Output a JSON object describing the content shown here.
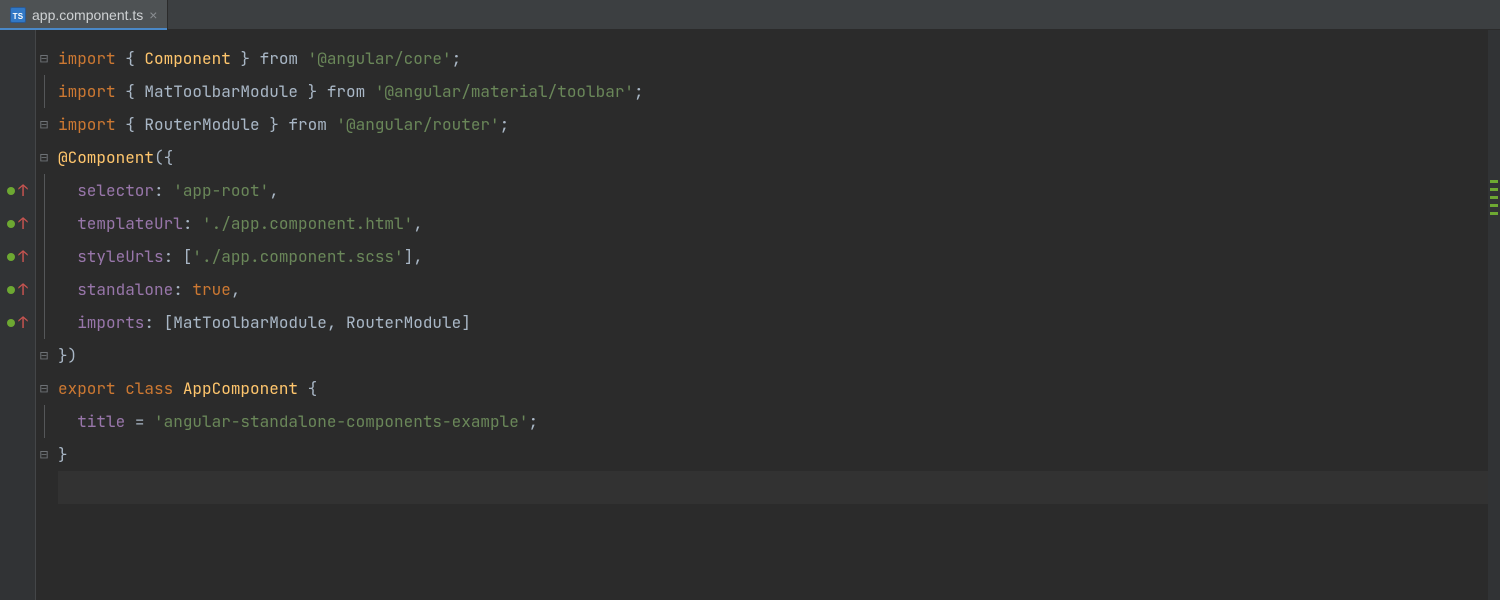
{
  "tab": {
    "filename": "app.component.ts",
    "icon_label": "TS"
  },
  "code": {
    "lines": [
      {
        "fold": "open",
        "tokens": [
          "import ",
          "{ ",
          "Component",
          " }",
          " from ",
          "'@angular/core'",
          ";"
        ]
      },
      {
        "fold": "line",
        "tokens": [
          "import ",
          "{ ",
          "MatToolbarModule",
          " }",
          " from ",
          "'@angular/material/toolbar'",
          ";"
        ]
      },
      {
        "fold": "close",
        "tokens": [
          "import ",
          "{ ",
          "RouterModule",
          " }",
          " from ",
          "'@angular/router'",
          ";"
        ]
      },
      {
        "fold": "open",
        "tokens": [
          "@Component",
          "({"
        ]
      },
      {
        "vcs": true,
        "fold": "line",
        "indent": "  ",
        "tokens": [
          "selector",
          ": ",
          "'app-root'",
          ","
        ]
      },
      {
        "vcs": true,
        "fold": "line",
        "indent": "  ",
        "tokens": [
          "templateUrl",
          ": ",
          "'./app.component.html'",
          ","
        ]
      },
      {
        "vcs": true,
        "fold": "line",
        "indent": "  ",
        "tokens": [
          "styleUrls",
          ": [",
          "'./app.component.scss'",
          "],"
        ]
      },
      {
        "vcs": true,
        "fold": "line",
        "indent": "  ",
        "tokens": [
          "standalone",
          ": ",
          "true",
          ","
        ]
      },
      {
        "vcs": true,
        "fold": "line",
        "indent": "  ",
        "tokens": [
          "imports",
          ": [",
          "MatToolbarModule",
          ", ",
          "RouterModule",
          "]"
        ]
      },
      {
        "fold": "close",
        "tokens": [
          "})"
        ]
      },
      {
        "fold": "open",
        "tokens": [
          "export ",
          "class ",
          "AppComponent",
          " {"
        ]
      },
      {
        "fold": "line",
        "indent": "  ",
        "tokens": [
          "title",
          " = ",
          "'angular-standalone-components-example'",
          ";"
        ]
      },
      {
        "fold": "close",
        "tokens": [
          "}"
        ]
      },
      {
        "current": true,
        "tokens": [
          ""
        ]
      }
    ]
  },
  "token_classes": {
    "import ": "kw",
    "from ": "kw",
    "export ": "kw",
    "class ": "kw",
    "true": "kw",
    "{ ": "id",
    " }": "id",
    " {": "id",
    "}": "id",
    "})": "id",
    "({": "id",
    ": [": "id",
    "],": "id",
    "]": "id",
    ", ": "id",
    ": ": "id",
    " = ": "id",
    ";": "op",
    ",": "op",
    "Component": "name",
    "@Component": "name",
    "AppComponent": "name",
    "MatToolbarModule": "id",
    "RouterModule": "id",
    "selector": "prop",
    "templateUrl": "prop",
    "styleUrls": "prop",
    "standalone": "prop",
    "imports": "prop",
    "title": "prop",
    "'@angular/core'": "str",
    "'@angular/material/toolbar'": "str",
    "'@angular/router'": "str",
    "'app-root'": "str",
    "'./app.component.html'": "str",
    "'./app.component.scss'": "str",
    "'angular-standalone-components-example'": "str"
  }
}
